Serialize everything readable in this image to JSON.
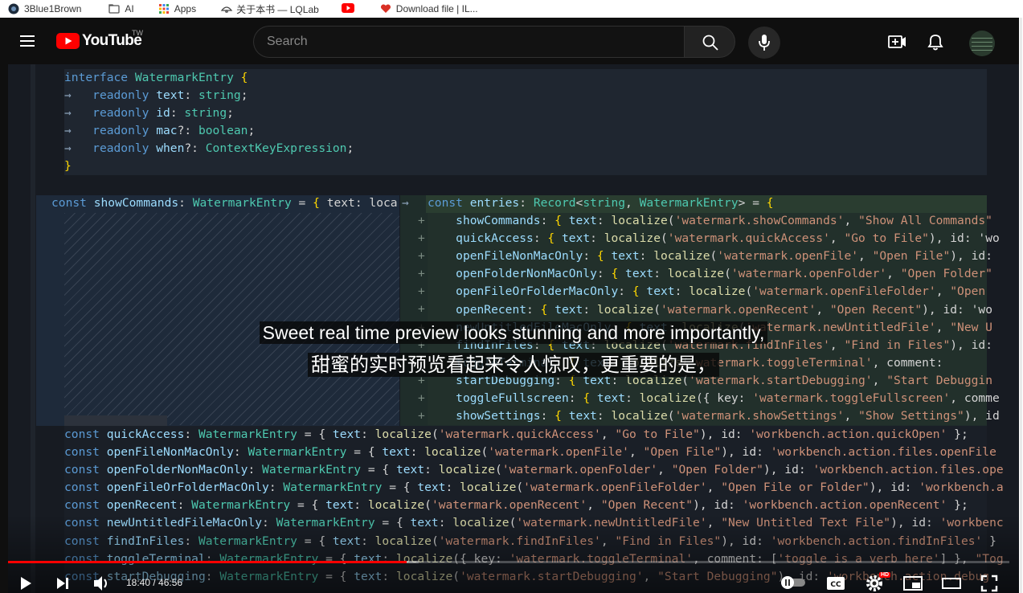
{
  "bookmarks": [
    {
      "label": "3Blue1Brown",
      "icon": "3b1b-icon"
    },
    {
      "label": "AI",
      "icon": "folder-icon"
    },
    {
      "label": "Apps",
      "icon": "apps-grid-icon"
    },
    {
      "label": "关于本书 — LQLab",
      "icon": "lqlab-icon"
    },
    {
      "label": "",
      "icon": "youtube-favicon-icon"
    },
    {
      "label": "Download file | IL...",
      "icon": "heart-icon"
    }
  ],
  "header": {
    "logo_text": "YouTube",
    "region": "TW",
    "search_placeholder": "Search"
  },
  "video": {
    "code_top": [
      [
        [
          "kw",
          "interface "
        ],
        [
          "ty",
          "WatermarkEntry "
        ],
        [
          "br",
          "{"
        ]
      ],
      [
        [
          "arr",
          "→   "
        ],
        [
          "kw",
          "readonly "
        ],
        [
          "prop",
          "text"
        ],
        [
          "pn",
          ": "
        ],
        [
          "ty",
          "string"
        ],
        [
          "pn",
          ";"
        ]
      ],
      [
        [
          "arr",
          "→   "
        ],
        [
          "kw",
          "readonly "
        ],
        [
          "prop",
          "id"
        ],
        [
          "pn",
          ": "
        ],
        [
          "ty",
          "string"
        ],
        [
          "pn",
          ";"
        ]
      ],
      [
        [
          "arr",
          "→   "
        ],
        [
          "kw",
          "readonly "
        ],
        [
          "prop",
          "mac"
        ],
        [
          "pn",
          "?: "
        ],
        [
          "ty",
          "boolean"
        ],
        [
          "pn",
          ";"
        ]
      ],
      [
        [
          "arr",
          "→   "
        ],
        [
          "kw",
          "readonly "
        ],
        [
          "prop",
          "when"
        ],
        [
          "pn",
          "?: "
        ],
        [
          "ty",
          "ContextKeyExpression"
        ],
        [
          "pn",
          ";"
        ]
      ],
      [
        [
          "br",
          "}"
        ]
      ]
    ],
    "diff_left_line": [
      [
        "kw",
        "const "
      ],
      [
        "prop",
        "showCommands"
      ],
      [
        "pn",
        ": "
      ],
      [
        "ty",
        "WatermarkEntry "
      ],
      [
        "pn",
        "= "
      ],
      [
        "br",
        "{ "
      ],
      [
        "pn",
        "text: loca"
      ]
    ],
    "diff_right": [
      [
        [
          "kw",
          "const "
        ],
        [
          "prop",
          "entries"
        ],
        [
          "pn",
          ": "
        ],
        [
          "ty",
          "Record"
        ],
        [
          "pn",
          "<"
        ],
        [
          "ty",
          "string"
        ],
        [
          "pn",
          ", "
        ],
        [
          "ty",
          "WatermarkEntry"
        ],
        [
          "pn",
          "> = "
        ],
        [
          "br",
          "{"
        ]
      ],
      [
        [
          "pn",
          "    "
        ],
        [
          "prop",
          "showCommands"
        ],
        [
          "pn",
          ": "
        ],
        [
          "br",
          "{ "
        ],
        [
          "prop",
          "text"
        ],
        [
          "pn",
          ": "
        ],
        [
          "fn",
          "localize"
        ],
        [
          "pn",
          "("
        ],
        [
          "str",
          "'watermark.showCommands'"
        ],
        [
          "pn",
          ", "
        ],
        [
          "str",
          "\"Show All Commands\""
        ]
      ],
      [
        [
          "pn",
          "    "
        ],
        [
          "prop",
          "quickAccess"
        ],
        [
          "pn",
          ": "
        ],
        [
          "br",
          "{ "
        ],
        [
          "prop",
          "text"
        ],
        [
          "pn",
          ": "
        ],
        [
          "fn",
          "localize"
        ],
        [
          "pn",
          "("
        ],
        [
          "str",
          "'watermark.quickAccess'"
        ],
        [
          "pn",
          ", "
        ],
        [
          "str",
          "\"Go to File\""
        ],
        [
          "pn",
          "), id: 'wo"
        ]
      ],
      [
        [
          "pn",
          "    "
        ],
        [
          "prop",
          "openFileNonMacOnly"
        ],
        [
          "pn",
          ": "
        ],
        [
          "br",
          "{ "
        ],
        [
          "prop",
          "text"
        ],
        [
          "pn",
          ": "
        ],
        [
          "fn",
          "localize"
        ],
        [
          "pn",
          "("
        ],
        [
          "str",
          "'watermark.openFile'"
        ],
        [
          "pn",
          ", "
        ],
        [
          "str",
          "\"Open File\""
        ],
        [
          "pn",
          "), id:"
        ]
      ],
      [
        [
          "pn",
          "    "
        ],
        [
          "prop",
          "openFolderNonMacOnly"
        ],
        [
          "pn",
          ": "
        ],
        [
          "br",
          "{ "
        ],
        [
          "prop",
          "text"
        ],
        [
          "pn",
          ": "
        ],
        [
          "fn",
          "localize"
        ],
        [
          "pn",
          "("
        ],
        [
          "str",
          "'watermark.openFolder'"
        ],
        [
          "pn",
          ", "
        ],
        [
          "str",
          "\"Open Folder\""
        ]
      ],
      [
        [
          "pn",
          "    "
        ],
        [
          "prop",
          "openFileOrFolderMacOnly"
        ],
        [
          "pn",
          ": "
        ],
        [
          "br",
          "{ "
        ],
        [
          "prop",
          "text"
        ],
        [
          "pn",
          ": "
        ],
        [
          "fn",
          "localize"
        ],
        [
          "pn",
          "("
        ],
        [
          "str",
          "'watermark.openFileFolder'"
        ],
        [
          "pn",
          ", "
        ],
        [
          "str",
          "\"Open"
        ]
      ],
      [
        [
          "pn",
          "    "
        ],
        [
          "prop",
          "openRecent"
        ],
        [
          "pn",
          ": "
        ],
        [
          "br",
          "{ "
        ],
        [
          "prop",
          "text"
        ],
        [
          "pn",
          ": "
        ],
        [
          "fn",
          "localize"
        ],
        [
          "pn",
          "("
        ],
        [
          "str",
          "'watermark.openRecent'"
        ],
        [
          "pn",
          ", "
        ],
        [
          "str",
          "\"Open Recent\""
        ],
        [
          "pn",
          "), id: 'wo"
        ]
      ],
      [
        [
          "pn",
          "    "
        ],
        [
          "prop",
          "newUntitledFileMacOnly"
        ],
        [
          "pn",
          ": "
        ],
        [
          "br",
          "{ "
        ],
        [
          "prop",
          "text"
        ],
        [
          "pn",
          ": "
        ],
        [
          "fn",
          "localize"
        ],
        [
          "pn",
          "("
        ],
        [
          "str",
          "'watermark.newUntitledFile'"
        ],
        [
          "pn",
          ", "
        ],
        [
          "str",
          "\"New U"
        ]
      ],
      [
        [
          "pn",
          "    "
        ],
        [
          "prop",
          "findInFiles"
        ],
        [
          "pn",
          ": "
        ],
        [
          "br",
          "{ "
        ],
        [
          "prop",
          "text"
        ],
        [
          "pn",
          ": "
        ],
        [
          "fn",
          "localize"
        ],
        [
          "pn",
          "("
        ],
        [
          "str",
          "'watermark.findInFiles'"
        ],
        [
          "pn",
          ", "
        ],
        [
          "str",
          "\"Find in Files\""
        ],
        [
          "pn",
          "), id:"
        ]
      ],
      [
        [
          "pn",
          "    "
        ],
        [
          "prop",
          "toggleTerminal"
        ],
        [
          "pn",
          ": "
        ],
        [
          "br",
          "{ "
        ],
        [
          "prop",
          "text"
        ],
        [
          "pn",
          ": "
        ],
        [
          "fn",
          "localize"
        ],
        [
          "pn",
          "("
        ],
        [
          "str",
          "'watermark.toggleTerminal'"
        ],
        [
          "pn",
          ", comment:"
        ]
      ],
      [
        [
          "pn",
          "    "
        ],
        [
          "prop",
          "startDebugging"
        ],
        [
          "pn",
          ": "
        ],
        [
          "br",
          "{ "
        ],
        [
          "prop",
          "text"
        ],
        [
          "pn",
          ": "
        ],
        [
          "fn",
          "localize"
        ],
        [
          "pn",
          "("
        ],
        [
          "str",
          "'watermark.startDebugging'"
        ],
        [
          "pn",
          ", "
        ],
        [
          "str",
          "\"Start Debuggin"
        ]
      ],
      [
        [
          "pn",
          "    "
        ],
        [
          "prop",
          "toggleFullscreen"
        ],
        [
          "pn",
          ": "
        ],
        [
          "br",
          "{ "
        ],
        [
          "prop",
          "text"
        ],
        [
          "pn",
          ": "
        ],
        [
          "fn",
          "localize"
        ],
        [
          "pn",
          "({ key: "
        ],
        [
          "str",
          "'watermark.toggleFullscreen'"
        ],
        [
          "pn",
          ", comme"
        ]
      ],
      [
        [
          "pn",
          "    "
        ],
        [
          "prop",
          "showSettings"
        ],
        [
          "pn",
          ": "
        ],
        [
          "br",
          "{ "
        ],
        [
          "prop",
          "text"
        ],
        [
          "pn",
          ": "
        ],
        [
          "fn",
          "localize"
        ],
        [
          "pn",
          "("
        ],
        [
          "str",
          "'watermark.showSettings'"
        ],
        [
          "pn",
          ", "
        ],
        [
          "str",
          "\"Show Settings\""
        ],
        [
          "pn",
          "), id"
        ]
      ]
    ],
    "code_bottom": [
      [
        [
          "kw",
          "const "
        ],
        [
          "prop",
          "quickAccess"
        ],
        [
          "pn",
          ": "
        ],
        [
          "ty",
          "WatermarkEntry "
        ],
        [
          "pn",
          "= { "
        ],
        [
          "prop",
          "text"
        ],
        [
          "pn",
          ": "
        ],
        [
          "fn",
          "localize"
        ],
        [
          "pn",
          "("
        ],
        [
          "str",
          "'watermark.quickAccess'"
        ],
        [
          "pn",
          ", "
        ],
        [
          "str",
          "\"Go to File\""
        ],
        [
          "pn",
          "), id: "
        ],
        [
          "str",
          "'workbench.action.quickOpen'"
        ],
        [
          "pn",
          " };"
        ]
      ],
      [
        [
          "kw",
          "const "
        ],
        [
          "prop",
          "openFileNonMacOnly"
        ],
        [
          "pn",
          ": "
        ],
        [
          "ty",
          "WatermarkEntry "
        ],
        [
          "pn",
          "= { "
        ],
        [
          "prop",
          "text"
        ],
        [
          "pn",
          ": "
        ],
        [
          "fn",
          "localize"
        ],
        [
          "pn",
          "("
        ],
        [
          "str",
          "'watermark.openFile'"
        ],
        [
          "pn",
          ", "
        ],
        [
          "str",
          "\"Open File\""
        ],
        [
          "pn",
          "), id: "
        ],
        [
          "str",
          "'workbench.action.files.openFile"
        ]
      ],
      [
        [
          "kw",
          "const "
        ],
        [
          "prop",
          "openFolderNonMacOnly"
        ],
        [
          "pn",
          ": "
        ],
        [
          "ty",
          "WatermarkEntry "
        ],
        [
          "pn",
          "= { "
        ],
        [
          "prop",
          "text"
        ],
        [
          "pn",
          ": "
        ],
        [
          "fn",
          "localize"
        ],
        [
          "pn",
          "("
        ],
        [
          "str",
          "'watermark.openFolder'"
        ],
        [
          "pn",
          ", "
        ],
        [
          "str",
          "\"Open Folder\""
        ],
        [
          "pn",
          "), id: "
        ],
        [
          "str",
          "'workbench.action.files.ope"
        ]
      ],
      [
        [
          "kw",
          "const "
        ],
        [
          "prop",
          "openFileOrFolderMacOnly"
        ],
        [
          "pn",
          ": "
        ],
        [
          "ty",
          "WatermarkEntry "
        ],
        [
          "pn",
          "= { "
        ],
        [
          "prop",
          "text"
        ],
        [
          "pn",
          ": "
        ],
        [
          "fn",
          "localize"
        ],
        [
          "pn",
          "("
        ],
        [
          "str",
          "'watermark.openFileFolder'"
        ],
        [
          "pn",
          ", "
        ],
        [
          "str",
          "\"Open File or Folder\""
        ],
        [
          "pn",
          "), id: "
        ],
        [
          "str",
          "'workbench.a"
        ]
      ],
      [
        [
          "kw",
          "const "
        ],
        [
          "prop",
          "openRecent"
        ],
        [
          "pn",
          ": "
        ],
        [
          "ty",
          "WatermarkEntry "
        ],
        [
          "pn",
          "= { "
        ],
        [
          "prop",
          "text"
        ],
        [
          "pn",
          ": "
        ],
        [
          "fn",
          "localize"
        ],
        [
          "pn",
          "("
        ],
        [
          "str",
          "'watermark.openRecent'"
        ],
        [
          "pn",
          ", "
        ],
        [
          "str",
          "\"Open Recent\""
        ],
        [
          "pn",
          "), id: "
        ],
        [
          "str",
          "'workbench.action.openRecent'"
        ],
        [
          "pn",
          " };"
        ]
      ],
      [
        [
          "kw",
          "const "
        ],
        [
          "prop",
          "newUntitledFileMacOnly"
        ],
        [
          "pn",
          ": "
        ],
        [
          "ty",
          "WatermarkEntry "
        ],
        [
          "pn",
          "= { "
        ],
        [
          "prop",
          "text"
        ],
        [
          "pn",
          ": "
        ],
        [
          "fn",
          "localize"
        ],
        [
          "pn",
          "("
        ],
        [
          "str",
          "'watermark.newUntitledFile'"
        ],
        [
          "pn",
          ", "
        ],
        [
          "str",
          "\"New Untitled Text File\""
        ],
        [
          "pn",
          "), id: "
        ],
        [
          "str",
          "'workbenc"
        ]
      ],
      [
        [
          "kw",
          "const "
        ],
        [
          "prop",
          "findInFiles"
        ],
        [
          "pn",
          ": "
        ],
        [
          "ty",
          "WatermarkEntry "
        ],
        [
          "pn",
          "= { "
        ],
        [
          "prop",
          "text"
        ],
        [
          "pn",
          ": "
        ],
        [
          "fn",
          "localize"
        ],
        [
          "pn",
          "("
        ],
        [
          "str",
          "'watermark.findInFiles'"
        ],
        [
          "pn",
          ", "
        ],
        [
          "str",
          "\"Find in Files\""
        ],
        [
          "pn",
          "), id: "
        ],
        [
          "str",
          "'workbench.action.findInFiles'"
        ],
        [
          "pn",
          " }"
        ]
      ],
      [
        [
          "kw",
          "const "
        ],
        [
          "prop",
          "toggleTerminal"
        ],
        [
          "pn",
          ": "
        ],
        [
          "ty",
          "WatermarkEntry "
        ],
        [
          "pn",
          "= { "
        ],
        [
          "prop",
          "text"
        ],
        [
          "pn",
          ": "
        ],
        [
          "fn",
          "localize"
        ],
        [
          "pn",
          "({ key: "
        ],
        [
          "str",
          "'watermark.toggleTerminal'"
        ],
        [
          "pn",
          ", comment: ["
        ],
        [
          "str",
          "'toggle is a verb here'"
        ],
        [
          "pn",
          "] }, "
        ],
        [
          "str",
          "\"Tog"
        ]
      ],
      [
        [
          "kw",
          "const "
        ],
        [
          "prop",
          "startDebugging"
        ],
        [
          "pn",
          ": "
        ],
        [
          "ty",
          "WatermarkEntry "
        ],
        [
          "pn",
          "= { "
        ],
        [
          "prop",
          "text"
        ],
        [
          "pn",
          ": "
        ],
        [
          "fn",
          "localize"
        ],
        [
          "pn",
          "("
        ],
        [
          "str",
          "'watermark.startDebugging'"
        ],
        [
          "pn",
          ", "
        ],
        [
          "str",
          "\"Start Debugging\""
        ],
        [
          "pn",
          "), id: "
        ],
        [
          "str",
          "'workbench.action.debug"
        ]
      ]
    ],
    "caption_en": "Sweet real time preview looks stunning and more importantly,",
    "caption_zh": "甜蜜的实时预览看起来令人惊叹，更重要的是，"
  },
  "player": {
    "time_current": "18:40",
    "time_total": "46:56",
    "time_display": "18:40 / 46:56",
    "progress": 0.398,
    "buffered": 0.41,
    "hd_badge": "HD"
  }
}
